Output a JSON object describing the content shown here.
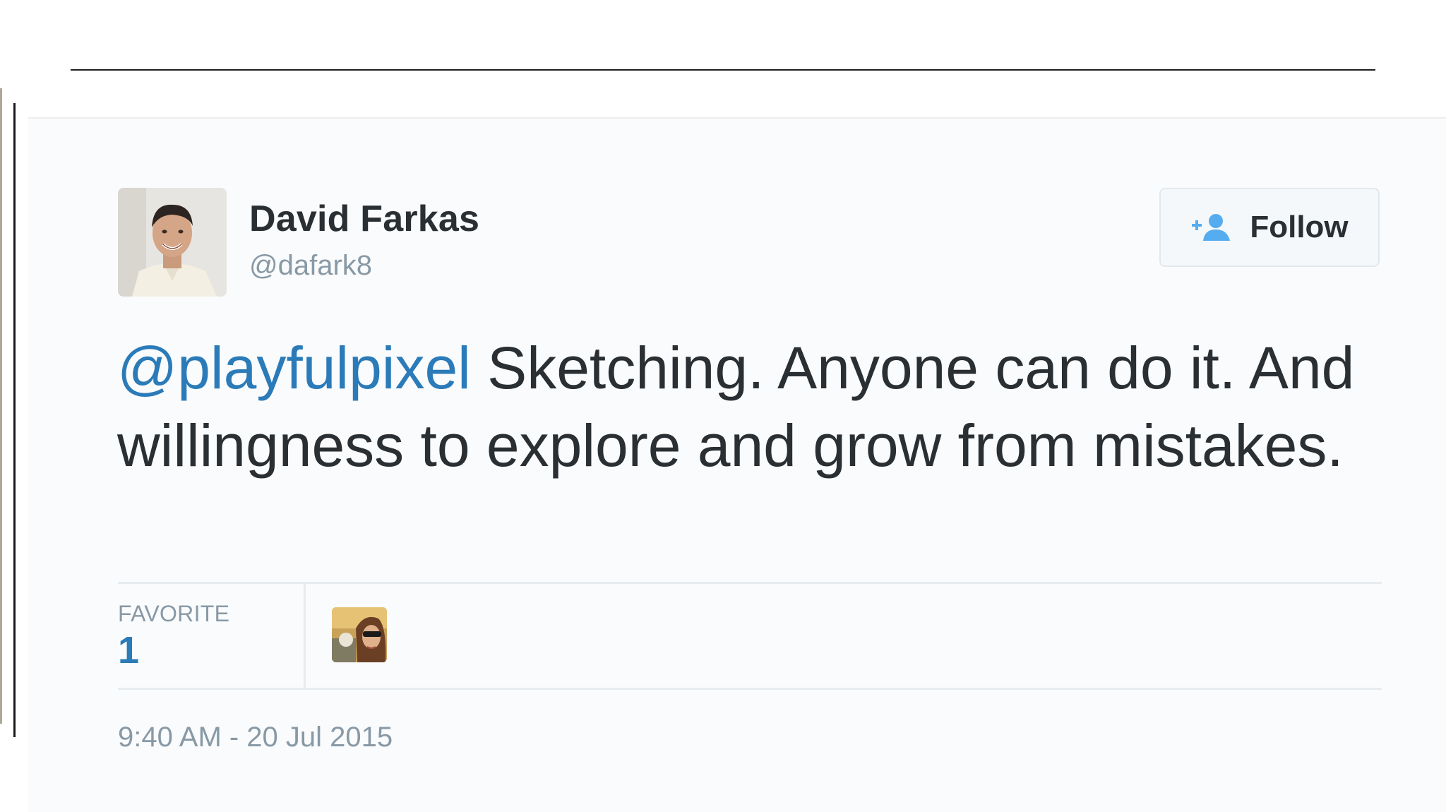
{
  "tweet": {
    "author": {
      "name": "David Farkas",
      "handle": "@dafark8"
    },
    "follow_button": {
      "label": "Follow",
      "icon": "follow-user-plus-icon"
    },
    "text": {
      "mention": "@playfulpixel",
      "body": " Sketching. Anyone can do it. And willingness to explore and grow from mistakes."
    },
    "stats": {
      "favorites_label": "FAVORITE",
      "favorites_count": "1"
    },
    "timestamp": "9:40 AM - 20 Jul 2015"
  },
  "colors": {
    "link": "#2b7bb9",
    "text": "#292f33",
    "muted": "#8899a6",
    "divider": "#e6ecf0"
  }
}
